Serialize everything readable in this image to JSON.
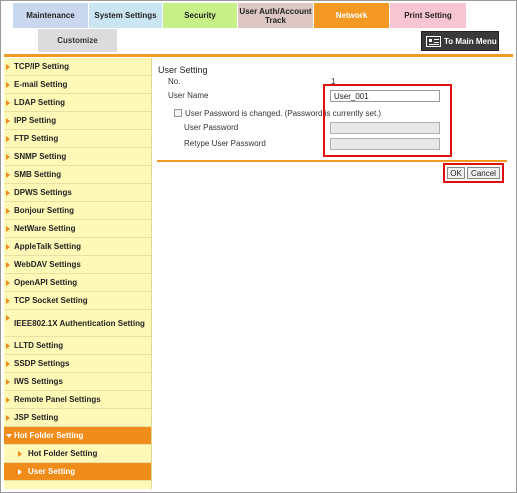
{
  "tabs": [
    {
      "label": "Maintenance"
    },
    {
      "label": "System Settings"
    },
    {
      "label": "Security"
    },
    {
      "label": "User Auth/Account Track"
    },
    {
      "label": "Network"
    },
    {
      "label": "Print Setting"
    }
  ],
  "toolbar": {
    "customize": "Customize",
    "to_main_menu": "To Main Menu"
  },
  "sidebar": {
    "items": [
      {
        "label": "TCP/IP Setting"
      },
      {
        "label": "E-mail Setting"
      },
      {
        "label": "LDAP Setting"
      },
      {
        "label": "IPP Setting"
      },
      {
        "label": "FTP Setting"
      },
      {
        "label": "SNMP Setting"
      },
      {
        "label": "SMB Setting"
      },
      {
        "label": "DPWS Settings"
      },
      {
        "label": "Bonjour Setting"
      },
      {
        "label": "NetWare Setting"
      },
      {
        "label": "AppleTalk Setting"
      },
      {
        "label": "WebDAV Settings"
      },
      {
        "label": "OpenAPI Setting"
      },
      {
        "label": "TCP Socket Setting"
      },
      {
        "label": "IEEE802.1X Authentication Setting"
      },
      {
        "label": "LLTD Setting"
      },
      {
        "label": "SSDP Settings"
      },
      {
        "label": "IWS Settings"
      },
      {
        "label": "Remote Panel Settings"
      },
      {
        "label": "JSP Setting"
      },
      {
        "label": "Hot Folder Setting"
      },
      {
        "label": "Hot Folder Setting"
      },
      {
        "label": "User Setting"
      }
    ]
  },
  "form": {
    "heading": "User Setting",
    "no_label": "No.",
    "no_value": "1",
    "user_name_label": "User Name",
    "user_name_value": "User_001",
    "password_changed_label": "User Password is changed. (Password is currently set.)",
    "user_password_label": "User Password",
    "retype_password_label": "Retype User Password",
    "ok": "OK",
    "cancel": "Cancel"
  },
  "colors": {
    "accent": "#f49a24",
    "highlight": "#d11111",
    "sidebar_bg": "#fff9b8"
  }
}
